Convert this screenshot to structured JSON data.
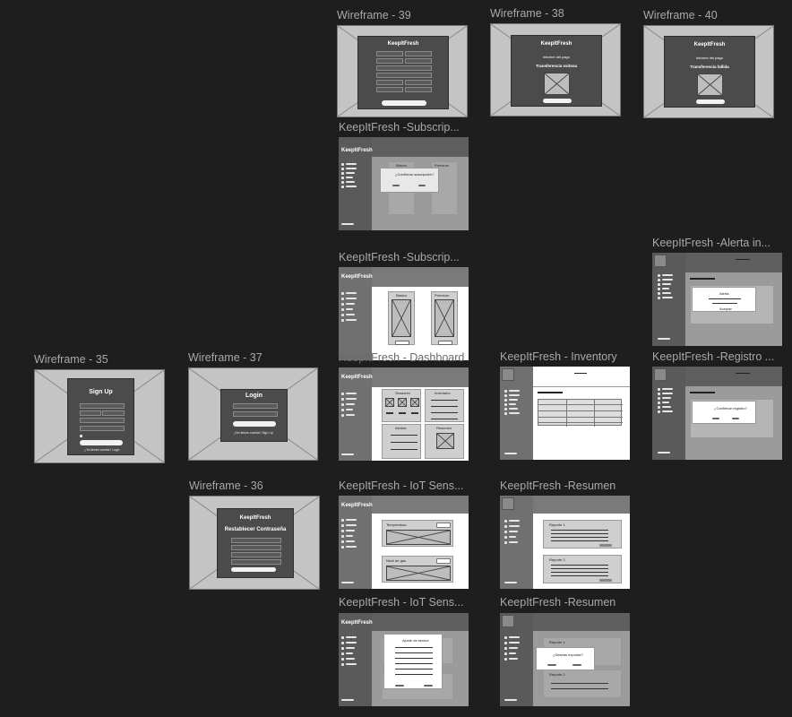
{
  "frames": {
    "wf39": {
      "title": "Wireframe - 39",
      "brand": "KeepItFresh",
      "button": "Pagar"
    },
    "wf38": {
      "title": "Wireframe - 38",
      "brand": "KeepItFresh",
      "subtitle": "Informe del pago",
      "status": "Transferencia exitosa",
      "button": "Continuar"
    },
    "wf40": {
      "title": "Wireframe - 40",
      "brand": "KeepItFresh",
      "subtitle": "Informe del pago",
      "status": "Transferencia fallida",
      "button": "Continuar"
    },
    "subs1": {
      "title": "KeepItFresh -Subscrip...",
      "brand": "KeepItFresh",
      "plan_a": "Básico",
      "plan_b": "Premium",
      "modal_text": "¿Confirmar suscripción?"
    },
    "subs2": {
      "title": "KeepItFresh -Subscrip...",
      "brand": "KeepItFresh",
      "plan_a": "Básico",
      "plan_b": "Premium"
    },
    "alerta": {
      "title": "KeepItFresh -Alerta in...",
      "modal_title": "Alerta",
      "modal_text": "Aceptar"
    },
    "wf35": {
      "title": "Wireframe - 35",
      "heading": "Sign Up",
      "button": "Crear cuenta",
      "footer": "¿Ya tienes cuenta? Login"
    },
    "wf37": {
      "title": "Wireframe - 37",
      "heading": "Login",
      "button": "Ingresar",
      "footer": "¿No tienes cuenta? Sign Up"
    },
    "dash": {
      "title": "KeepItFresh - Dashboard",
      "brand": "KeepItFresh",
      "panel_a": "Sensores",
      "panel_b": "Inventario",
      "panel_c": "Alertas",
      "panel_d": "Resumen"
    },
    "inventory": {
      "title": "KeepItFresh - Inventory",
      "brand": "KeepItFresh"
    },
    "registro": {
      "title": "KeepItFresh -Registro ...",
      "modal_text": "¿Confirmar registro?"
    },
    "wf36": {
      "title": "Wireframe - 36",
      "brand": "KeepItFresh",
      "heading": "Restablecer Contraseña",
      "button": "Restablecer"
    },
    "iot1": {
      "title": "KeepItFresh - IoT Sens...",
      "brand": "KeepItFresh",
      "card_a": "Temperatura",
      "card_b": "Nivel de gas"
    },
    "resumen1": {
      "title": "KeepItFresh -Resumen",
      "brand": "KeepItFresh",
      "card_a": "Reporte 1",
      "card_b": "Reporte 2"
    },
    "iot2": {
      "title": "KeepItFresh - IoT Sens...",
      "brand": "KeepItFresh",
      "modal_title": "Ajuste de sensor"
    },
    "resumen2": {
      "title": "KeepItFresh -Resumen",
      "brand": "KeepItFresh",
      "card_a": "Reporte 1",
      "card_b": "Reporte 2",
      "modal_text": "¿Deseas exportar?"
    }
  }
}
